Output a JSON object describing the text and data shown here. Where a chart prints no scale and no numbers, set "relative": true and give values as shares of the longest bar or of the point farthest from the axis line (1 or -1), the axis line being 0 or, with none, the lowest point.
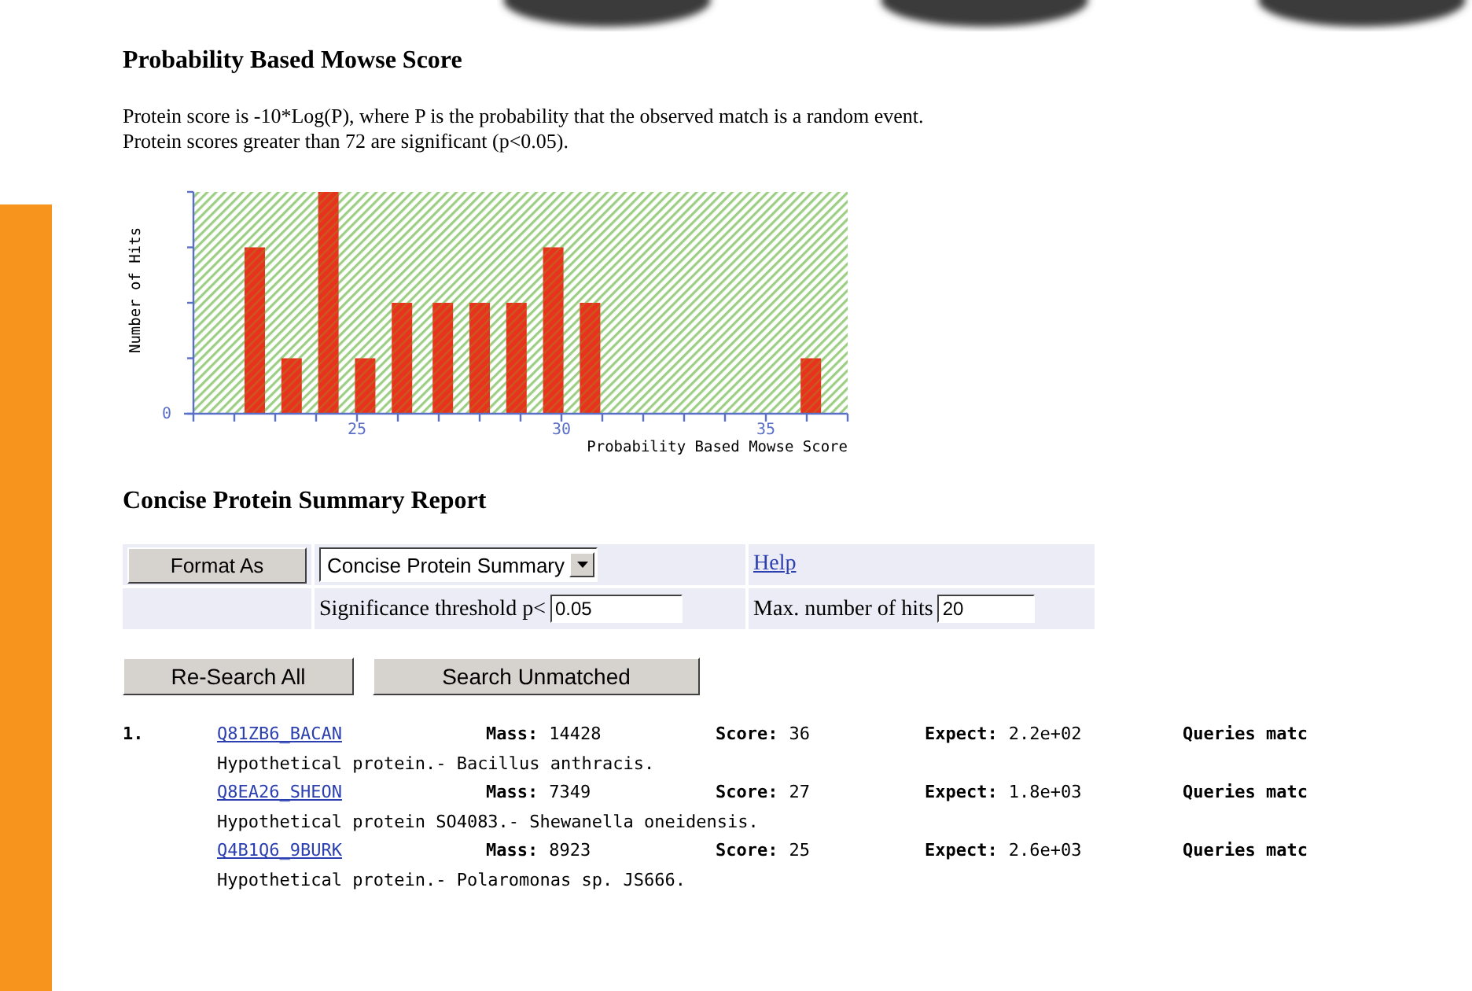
{
  "score_section": {
    "title": "Probability Based Mowse Score",
    "lines": [
      "Protein score is -10*Log(P), where P is the probability that the observed match is a random event.",
      "Protein scores greater than 72 are significant (p<0.05)."
    ],
    "chart_data": {
      "type": "bar",
      "xlabel": "Probability Based Mowse Score",
      "ylabel": "Number of Hits",
      "x": [
        22.5,
        23.4,
        24.3,
        25.2,
        26.1,
        27.1,
        28.0,
        28.9,
        29.8,
        30.7,
        36.1
      ],
      "series": [
        {
          "color": "#e8321e",
          "values": [
            0.75,
            0.25,
            1,
            0.25,
            0.5,
            0.5,
            0.5,
            0.5,
            0.75,
            0.5,
            0.25
          ]
        }
      ],
      "xlim": [
        21,
        37
      ],
      "xticks": [
        25,
        30,
        35
      ],
      "relative": true,
      "annotations": [
        {
          "text": "0"
        }
      ]
    }
  },
  "report": {
    "title": "Concise Protein Summary Report",
    "format_button": "Format As",
    "format_select": "Concise Protein Summary",
    "help_link": "Help",
    "threshold_label": "Significance threshold p<",
    "threshold_value": "0.05",
    "max_hits_label": "Max. number of hits",
    "max_hits_value": "20",
    "buttons": [
      "Re-Search All",
      "Search Unmatched"
    ],
    "hits": [
      {
        "number": "1.",
        "proteins": [
          {
            "accession": "Q81ZB6_BACAN",
            "fields": [
              {
                "label": "Mass:",
                "value": "14428"
              },
              {
                "label": "Score:",
                "value": "36"
              },
              {
                "label": "Expect:",
                "value": "2.2e+02"
              },
              {
                "label": "Queries matc"
              }
            ],
            "description": "Hypothetical protein.- Bacillus anthracis."
          },
          {
            "accession": "Q8EA26_SHEON",
            "fields": [
              {
                "label": "Mass:",
                "value": "7349"
              },
              {
                "label": "Score:",
                "value": "27"
              },
              {
                "label": "Expect:",
                "value": "1.8e+03"
              },
              {
                "label": "Queries matc"
              }
            ],
            "description": "Hypothetical protein SO4083.- Shewanella oneidensis."
          },
          {
            "accession": "Q4B1Q6_9BURK",
            "fields": [
              {
                "label": "Mass:",
                "value": "8923"
              },
              {
                "label": "Score:",
                "value": "25"
              },
              {
                "label": "Expect:",
                "value": "2.6e+03"
              },
              {
                "label": "Queries matc"
              }
            ],
            "description": "Hypothetical protein.- Polaromonas sp. JS666."
          }
        ]
      }
    ]
  }
}
